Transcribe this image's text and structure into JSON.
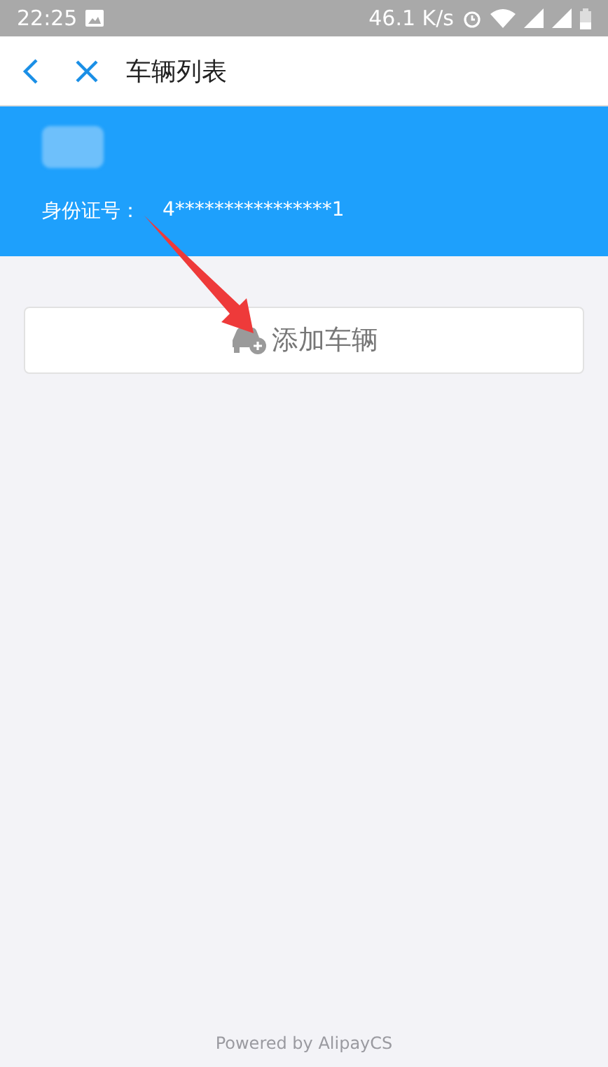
{
  "status_bar": {
    "time": "22:25",
    "speed": "46.1 K/s"
  },
  "nav_bar": {
    "title": "车辆列表"
  },
  "profile": {
    "id_label": "身份证号：",
    "id_value": "4****************1"
  },
  "add_button": {
    "label": "添加车辆"
  },
  "footer": "Powered by AlipayCS"
}
